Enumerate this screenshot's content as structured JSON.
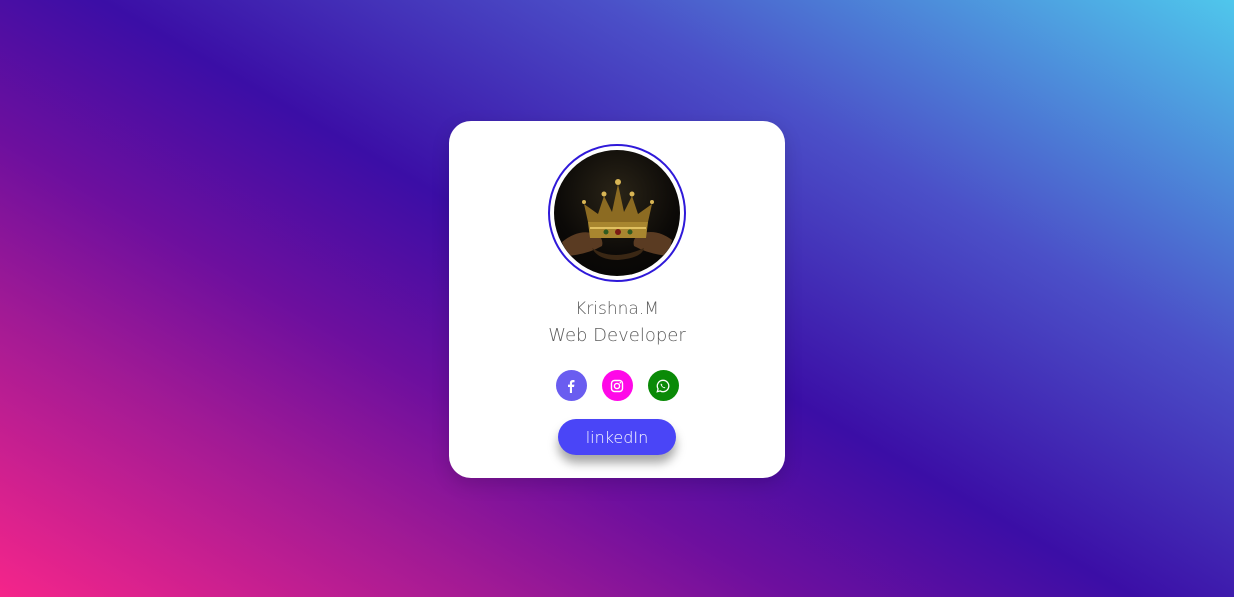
{
  "profile": {
    "name": "Krishna.M",
    "title": "Web Developer"
  },
  "socials": [
    {
      "name": "facebook",
      "icon": "facebook-icon",
      "color": "#6a5df0"
    },
    {
      "name": "instagram",
      "icon": "instagram-icon",
      "color": "#ff08e8"
    },
    {
      "name": "whatsapp",
      "icon": "whatsapp-icon",
      "color": "#0a8a07"
    }
  ],
  "button": {
    "label": "linkedIn",
    "color": "#4a45f7"
  },
  "colors": {
    "avatar_ring": "#2f19d9",
    "card": "#ffffff",
    "text": "#5b5b5b"
  }
}
